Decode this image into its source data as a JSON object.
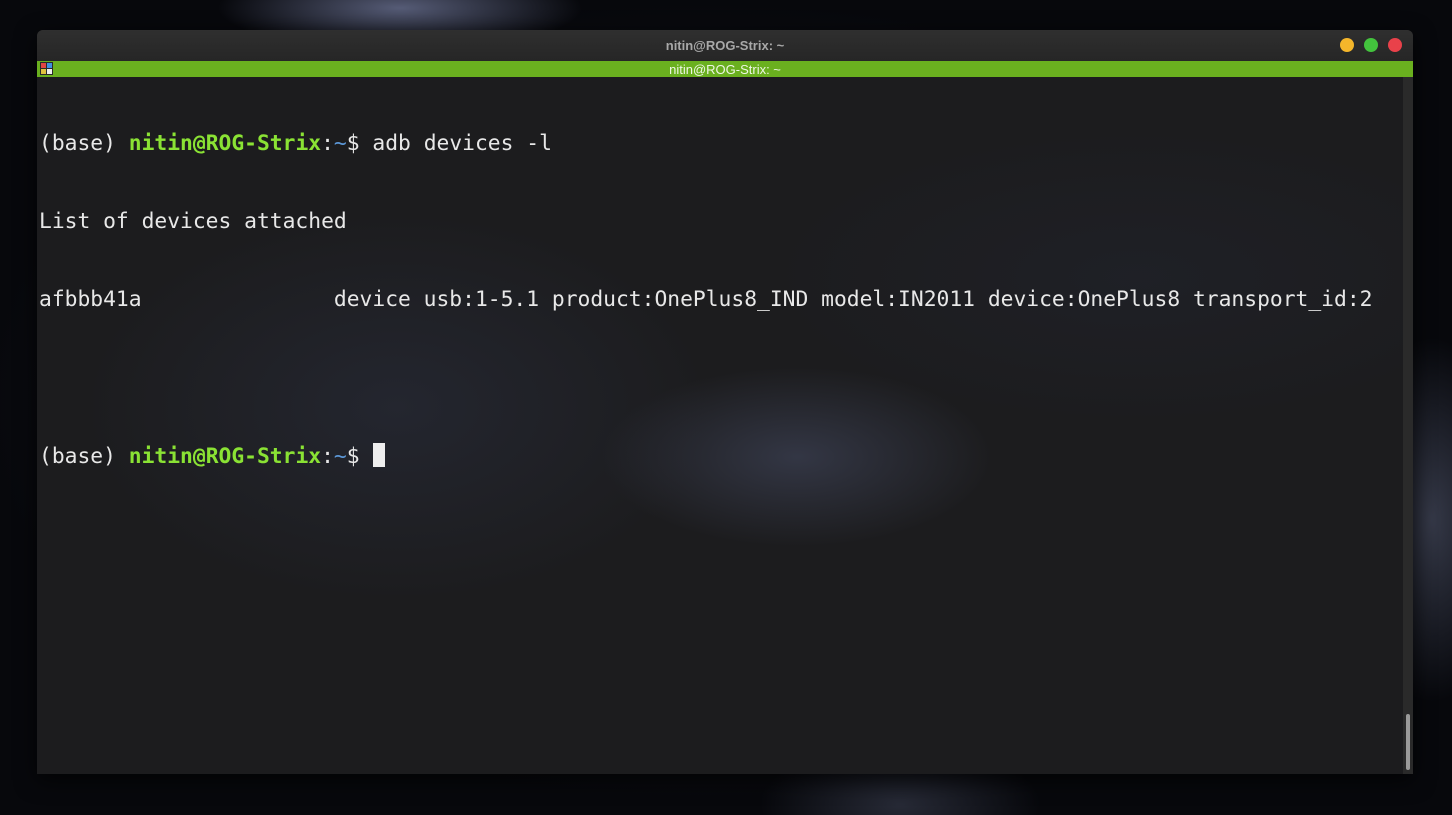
{
  "window": {
    "title": "nitin@ROG-Strix: ~"
  },
  "tab": {
    "title": "nitin@ROG-Strix: ~",
    "icon": "terminator-grid-icon"
  },
  "controls": [
    {
      "name": "minimize",
      "color": "#f4b62b"
    },
    {
      "name": "maximize",
      "color": "#43c33d"
    },
    {
      "name": "close",
      "color": "#e9414a"
    }
  ],
  "terminal": {
    "prompt1": {
      "env": "(base) ",
      "userhost": "nitin@ROG-Strix",
      "sep": ":",
      "path": "~",
      "symbol": "$ ",
      "command": "adb devices -l"
    },
    "output": [
      "List of devices attached",
      "afbbb41a               device usb:1-5.1 product:OnePlus8_IND model:IN2011 device:OnePlus8 transport_id:2",
      ""
    ],
    "prompt2": {
      "env": "(base) ",
      "userhost": "nitin@ROG-Strix",
      "sep": ":",
      "path": "~",
      "symbol": "$"
    }
  },
  "colors": {
    "tabbar": "#6ab01f",
    "prompt_user": "#8ae234",
    "prompt_path": "#5c97d6",
    "text": "#e8e8e8"
  }
}
